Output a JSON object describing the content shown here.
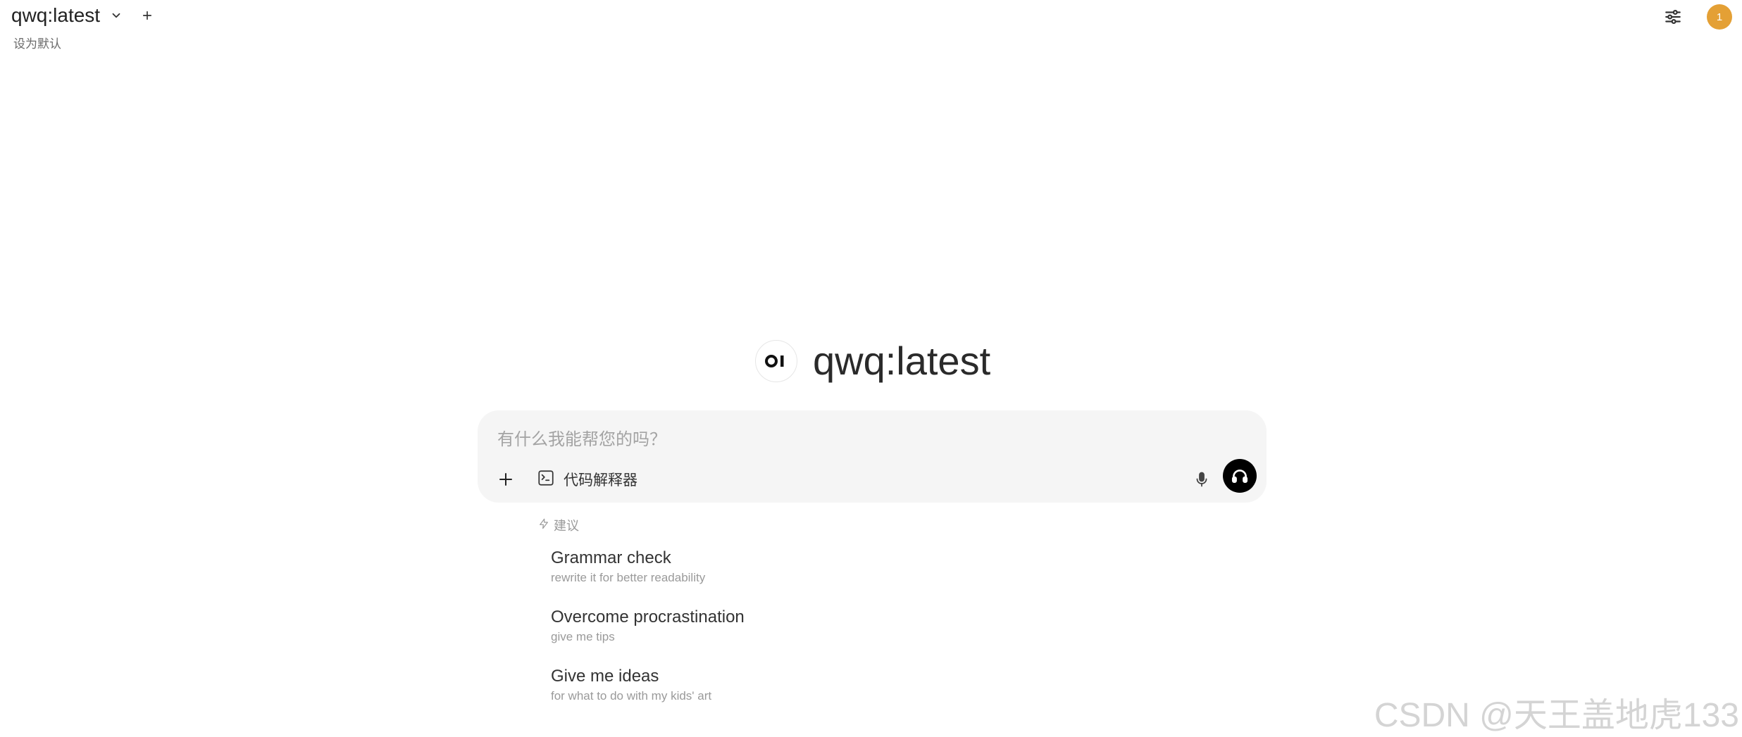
{
  "header": {
    "model_name": "qwq:latest",
    "set_default_label": "设为默认",
    "avatar_initial": "1",
    "avatar_color": "#e4a035"
  },
  "hero": {
    "logo_text": "OI",
    "title": "qwq:latest"
  },
  "input": {
    "placeholder": "有什么我能帮您的吗？",
    "value": "",
    "code_interpreter_label": "代码解释器"
  },
  "suggestions": {
    "header": "建议",
    "items": [
      {
        "title": "Grammar check",
        "subtitle": "rewrite it for better readability"
      },
      {
        "title": "Overcome procrastination",
        "subtitle": "give me tips"
      },
      {
        "title": "Give me ideas",
        "subtitle": "for what to do with my kids' art"
      }
    ]
  },
  "watermark": "CSDN @天王盖地虎133",
  "icons": {
    "chevron": "chevron-down-icon",
    "plus": "plus-icon",
    "controls": "sliders-icon",
    "terminal": "terminal-icon",
    "mic": "microphone-icon",
    "headphones": "headphones-icon",
    "bolt": "bolt-icon"
  }
}
